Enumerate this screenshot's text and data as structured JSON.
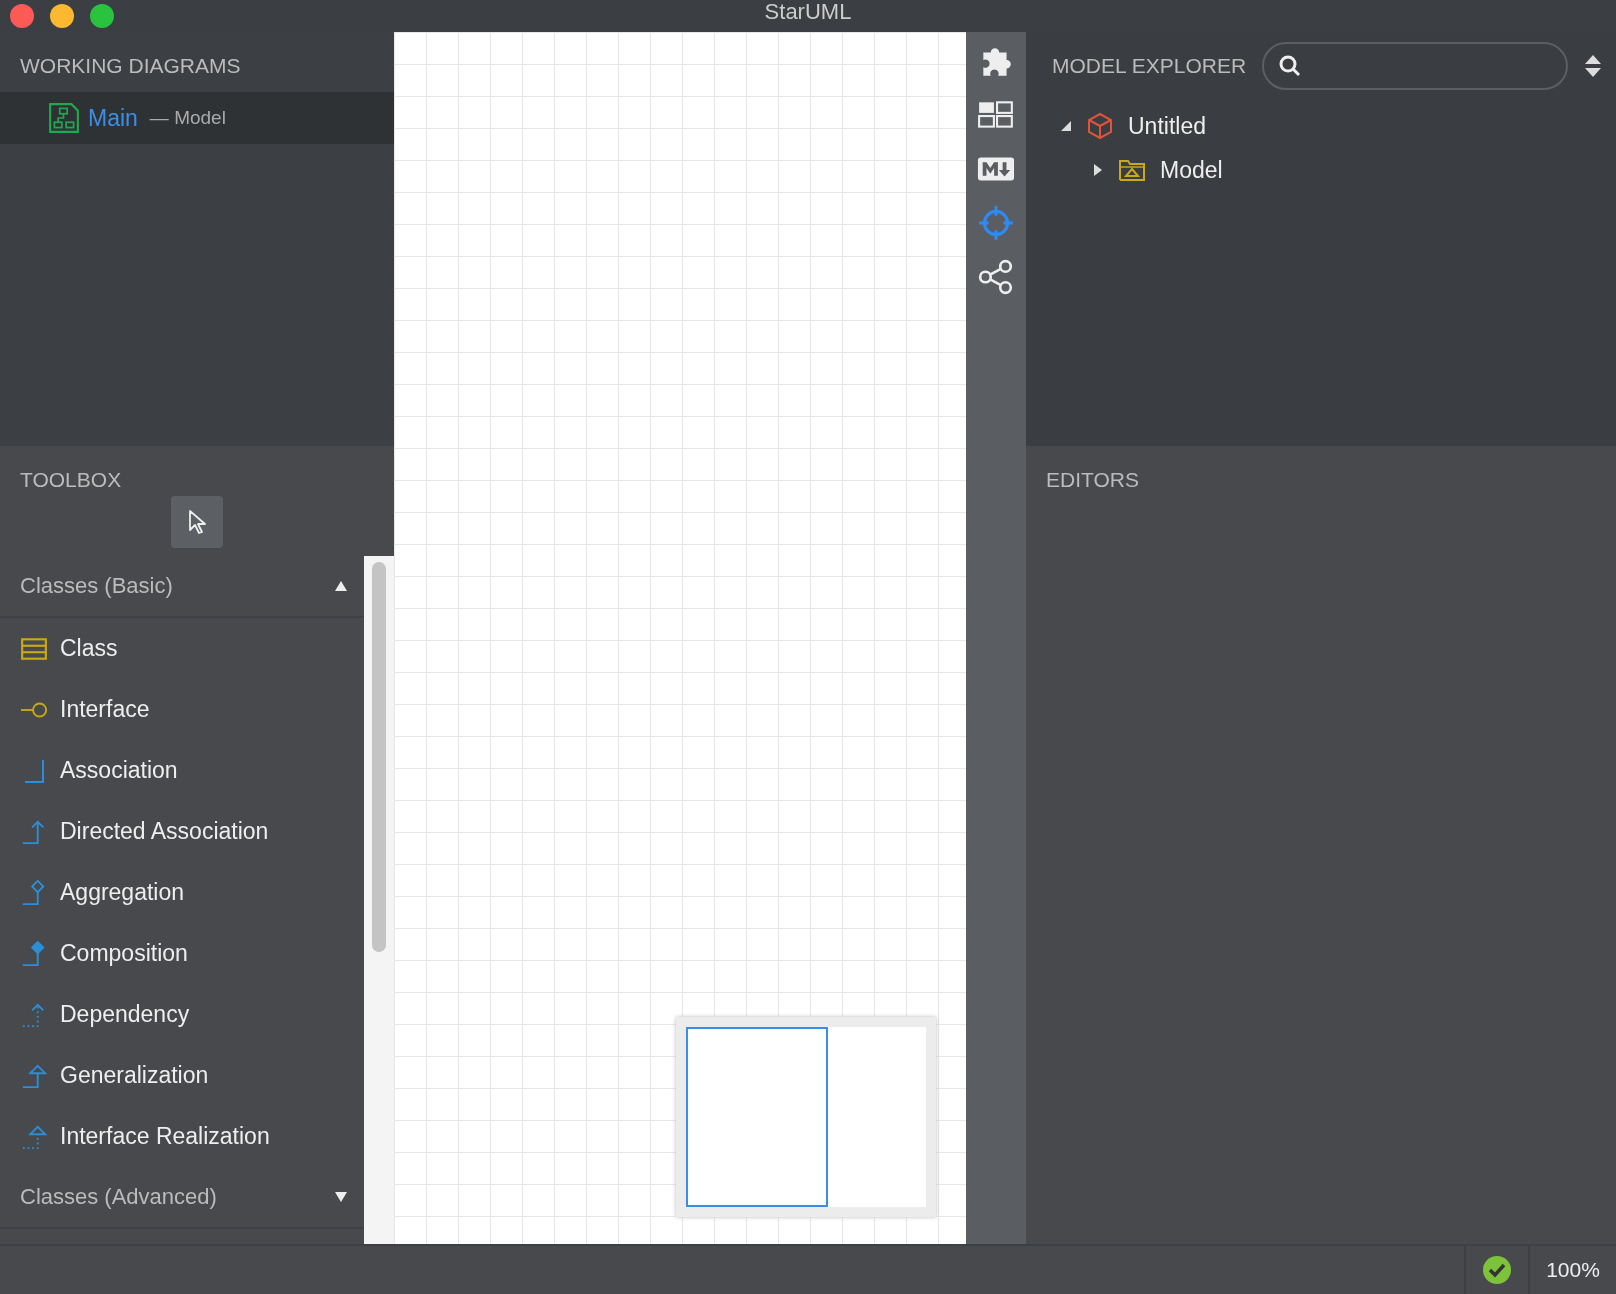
{
  "window": {
    "title": "StarUML"
  },
  "working_diagrams": {
    "title": "WORKING DIAGRAMS",
    "items": [
      {
        "name": "Main",
        "owner": "— Model",
        "selected": true
      }
    ]
  },
  "toolbox": {
    "title": "TOOLBOX",
    "groups": [
      {
        "title": "Classes (Basic)",
        "expanded": true,
        "items": [
          {
            "label": "Class",
            "kind": "class"
          },
          {
            "label": "Interface",
            "kind": "interface"
          },
          {
            "label": "Association",
            "kind": "association"
          },
          {
            "label": "Directed Association",
            "kind": "directed-association"
          },
          {
            "label": "Aggregation",
            "kind": "aggregation"
          },
          {
            "label": "Composition",
            "kind": "composition"
          },
          {
            "label": "Dependency",
            "kind": "dependency"
          },
          {
            "label": "Generalization",
            "kind": "generalization"
          },
          {
            "label": "Interface Realization",
            "kind": "interface-realization"
          }
        ]
      },
      {
        "title": "Classes (Advanced)",
        "expanded": false
      }
    ]
  },
  "model_explorer": {
    "title": "MODEL EXPLORER",
    "tree": [
      {
        "label": "Untitled",
        "kind": "project",
        "expanded": true,
        "children": [
          {
            "label": "Model",
            "kind": "model",
            "expanded": false
          }
        ]
      }
    ]
  },
  "editors": {
    "title": "EDITORS"
  },
  "status_bar": {
    "zoom": "100%"
  }
}
